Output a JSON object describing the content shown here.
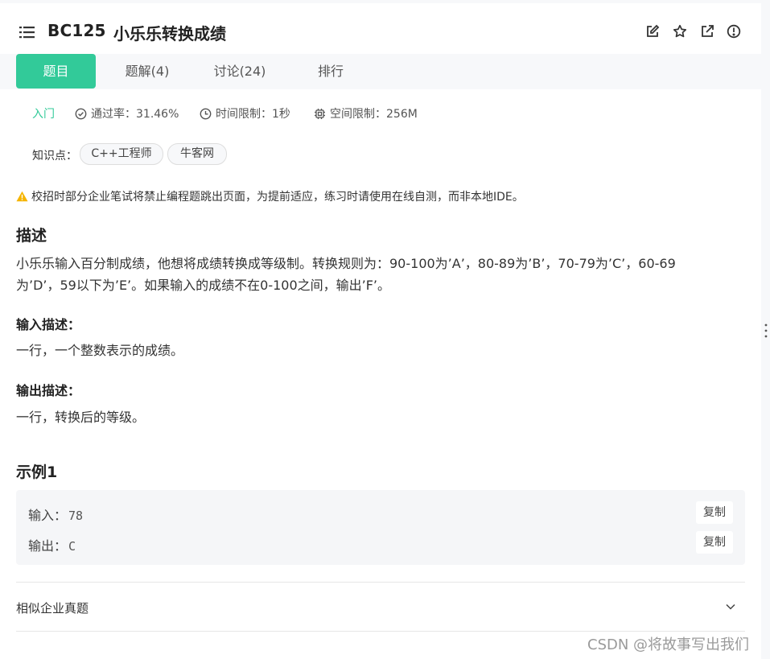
{
  "header": {
    "problem_id": "BC125",
    "problem_title": "小乐乐转换成绩",
    "icons": [
      "menu-icon",
      "edit-icon",
      "star-icon",
      "external-link-icon",
      "report-icon"
    ]
  },
  "tabs": [
    {
      "label": "题目",
      "active": true
    },
    {
      "label": "题解(4)",
      "active": false
    },
    {
      "label": "讨论(24)",
      "active": false
    },
    {
      "label": "排行",
      "active": false
    }
  ],
  "meta": {
    "level": "入门",
    "pass_rate": "通过率：31.46%",
    "time_limit": "时间限制：1秒",
    "space_limit": "空间限制：256M"
  },
  "knowledge": {
    "label": "知识点：",
    "tags": [
      "C++工程师",
      "牛客网"
    ]
  },
  "warning": "校招时部分企业笔试将禁止编程题跳出页面，为提前适应，练习时请使用在线自测，而非本地IDE。",
  "description": {
    "heading": "描述",
    "line1": "小乐乐输入百分制成绩，他想将成绩转换成等级制。转换规则为：90-100为’A’，80-89为’B’，70-79为’C’，60-69",
    "line2": "为’D’，59以下为’E’。如果输入的成绩不在0-100之间，输出’F’。"
  },
  "input_desc": {
    "heading": "输入描述：",
    "text": "一行，一个整数表示的成绩。"
  },
  "output_desc": {
    "heading": "输出描述：",
    "text": "一行，转换后的等级。"
  },
  "example": {
    "heading": "示例1",
    "input_label": "输入：",
    "input_value": "78",
    "output_label": "输出：",
    "output_value": "C",
    "copy_label": "复制"
  },
  "similar": {
    "label": "相似企业真题"
  },
  "watermark": "CSDN @将故事写出我们",
  "colors": {
    "accent": "#32ca99",
    "warning": "#f5b400",
    "page_bg": "#f7f8fa"
  }
}
